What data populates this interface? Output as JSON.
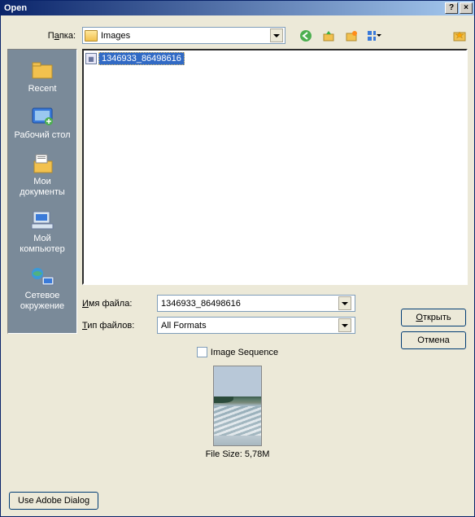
{
  "title": "Open",
  "folder_label_pre": "П",
  "folder_label_u": "а",
  "folder_label_post": "пка:",
  "folder_value": "Images",
  "places": {
    "recent": "Recent",
    "desktop": "Рабочий стол",
    "mydocs_l1": "Мои",
    "mydocs_l2": "документы",
    "mycomp_l1": "Мой",
    "mycomp_l2": "компьютер",
    "network_l1": "Сетевое",
    "network_l2": "окружение"
  },
  "file": {
    "name": "1346933_86498616"
  },
  "labels": {
    "filename_pre": "",
    "filename_u": "И",
    "filename_post": "мя файла:",
    "filetype_pre": "",
    "filetype_u": "Т",
    "filetype_post": "ип файлов:",
    "open_pre": "",
    "open_u": "О",
    "open_post": "ткрыть",
    "cancel": "Отмена",
    "image_seq": "Image Sequence",
    "filesize": "File Size: 5,78M",
    "adobe": "Use Adobe Dialog"
  },
  "values": {
    "filename": "1346933_86498616",
    "filetype": "All Formats"
  }
}
